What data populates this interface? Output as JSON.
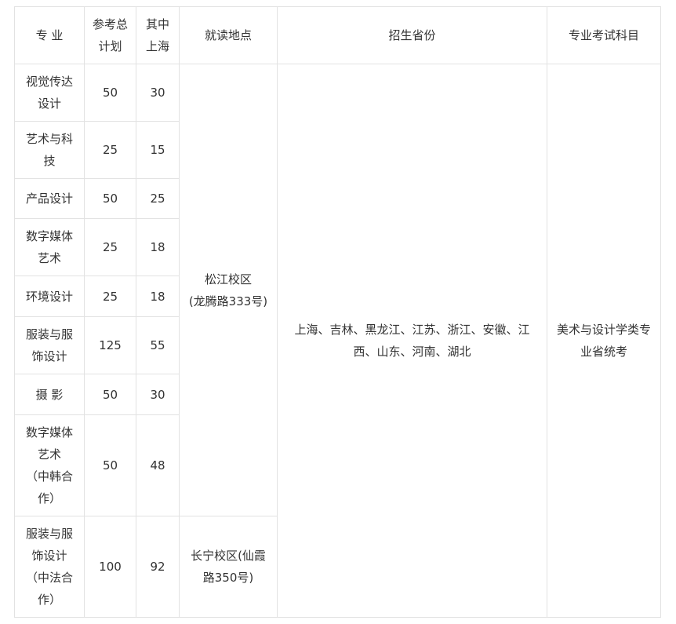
{
  "header": {
    "major": "专 业",
    "plan_total": "参考总\n计划",
    "shanghai": "其中\n上海",
    "location": "就读地点",
    "provinces": "招生省份",
    "exam": "专业考试科目"
  },
  "rows": [
    {
      "major": "视觉传达\n设计",
      "plan": "50",
      "shanghai": "30"
    },
    {
      "major": "艺术与科\n技",
      "plan": "25",
      "shanghai": "15"
    },
    {
      "major": "产品设计",
      "plan": "50",
      "shanghai": "25"
    },
    {
      "major": "数字媒体\n艺术",
      "plan": "25",
      "shanghai": "18"
    },
    {
      "major": "环境设计",
      "plan": "25",
      "shanghai": "18"
    },
    {
      "major": "服装与服\n饰设计",
      "plan": "125",
      "shanghai": "55"
    },
    {
      "major": "摄 影",
      "plan": "50",
      "shanghai": "30"
    },
    {
      "major": "数字媒体\n艺术\n（中韩合\n作）",
      "plan": "50",
      "shanghai": "48"
    },
    {
      "major": "服装与服\n饰设计\n（中法合\n作）",
      "plan": "100",
      "shanghai": "92"
    }
  ],
  "locations": {
    "songjiang": "松江校区\n(龙腾路333号)",
    "changning": "长宁校区(仙霞\n路350号)"
  },
  "provinces": "上海、吉林、黑龙江、江苏、浙江、安徽、江\n西、山东、河南、湖北",
  "exam": "美术与设计学类专\n业省统考"
}
